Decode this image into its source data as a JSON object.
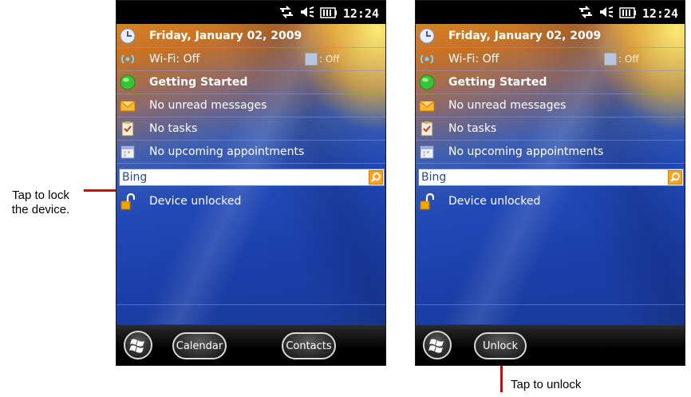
{
  "status": {
    "time": "12:24"
  },
  "today": {
    "date": "Friday, January 02, 2009",
    "wifi": "Wi-Fi: Off",
    "bluetooth_state": ": Off",
    "getting_started": "Getting Started",
    "messages": "No unread messages",
    "tasks": "No tasks",
    "appointments": "No upcoming appointments",
    "search_text": "Bing",
    "lock_status": "Device unlocked"
  },
  "left_softkeys": {
    "left": "Calendar",
    "right": "Contacts"
  },
  "right_softkeys": {
    "left": "Unlock"
  },
  "annotations": {
    "lock_line1": "Tap to lock",
    "lock_line2": "the device.",
    "unlock": "Tap to unlock"
  },
  "colors": {
    "accent": "#ff0000",
    "search_button": "#ffa41a",
    "lock_icon": "#f2a400"
  }
}
